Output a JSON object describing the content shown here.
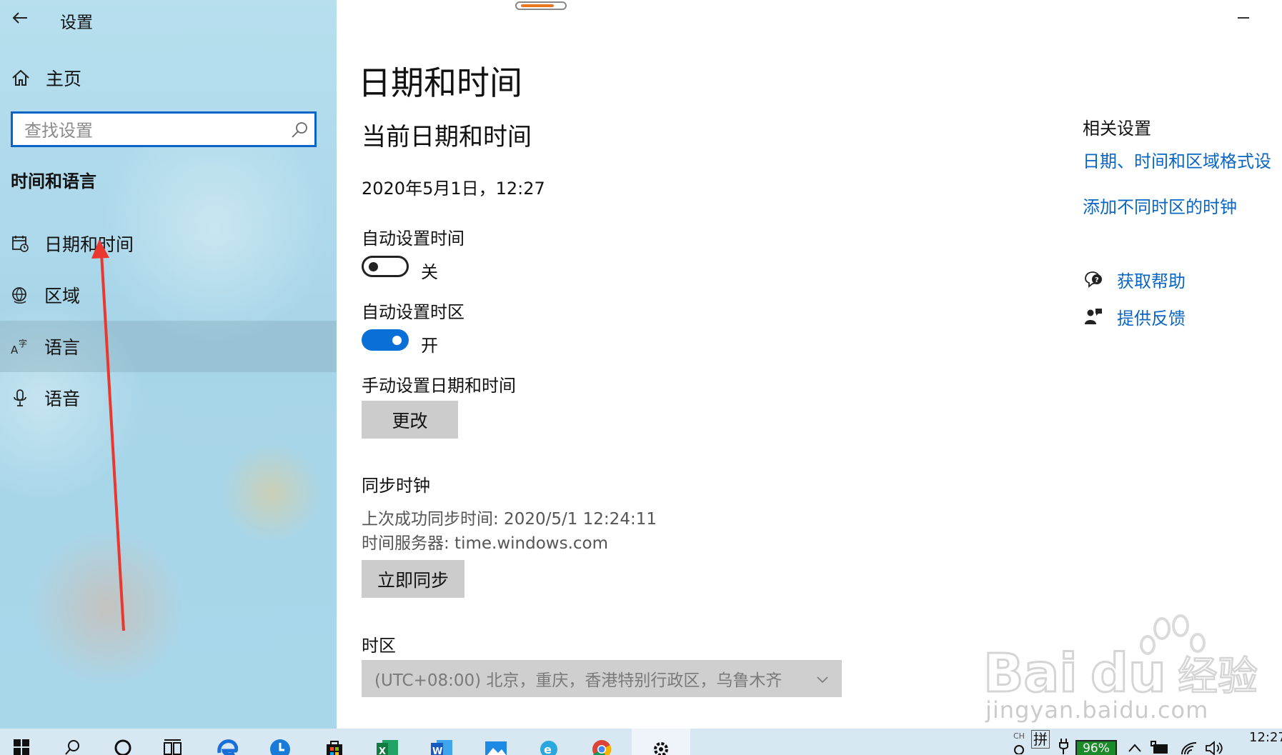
{
  "window": {
    "app_title": "设置"
  },
  "sidebar": {
    "home_label": "主页",
    "search_placeholder": "查找设置",
    "section_title": "时间和语言",
    "items": [
      {
        "label": "日期和时间",
        "icon": "calendar-clock-icon"
      },
      {
        "label": "区域",
        "icon": "globe-region-icon"
      },
      {
        "label": "语言",
        "icon": "language-icon",
        "selected": true
      },
      {
        "label": "语音",
        "icon": "microphone-icon"
      }
    ]
  },
  "main": {
    "page_title": "日期和时间",
    "section_title": "当前日期和时间",
    "current_datetime": "2020年5月1日，12:27",
    "auto_time": {
      "label": "自动设置时间",
      "state": "关",
      "on": false
    },
    "auto_timezone": {
      "label": "自动设置时区",
      "state": "开",
      "on": true
    },
    "manual": {
      "label": "手动设置日期和时间",
      "button": "更改"
    },
    "sync": {
      "label": "同步时钟",
      "last_sync": "上次成功同步时间: 2020/5/1 12:24:11",
      "server": "时间服务器: time.windows.com",
      "button": "立即同步"
    },
    "timezone": {
      "label": "时区",
      "value": "(UTC+08:00) 北京，重庆，香港特别行政区，乌鲁木齐"
    }
  },
  "related": {
    "title": "相关设置",
    "links": [
      "日期、时间和区域格式设",
      "添加不同时区的时钟"
    ],
    "help": "获取帮助",
    "feedback": "提供反馈"
  },
  "watermark": {
    "text": "jingyan.baidu.com"
  },
  "taskbar": {
    "apps": [
      "start",
      "search",
      "cortana",
      "task-view",
      "edge",
      "clock-app",
      "store",
      "excel",
      "word",
      "photos",
      "ie",
      "chrome",
      "settings"
    ],
    "ime_label": "拼",
    "battery": "96%",
    "time": "12:27"
  },
  "colors": {
    "accent": "#0a6fd6",
    "link": "#0a66c2",
    "annotation_arrow": "#e8382f"
  }
}
